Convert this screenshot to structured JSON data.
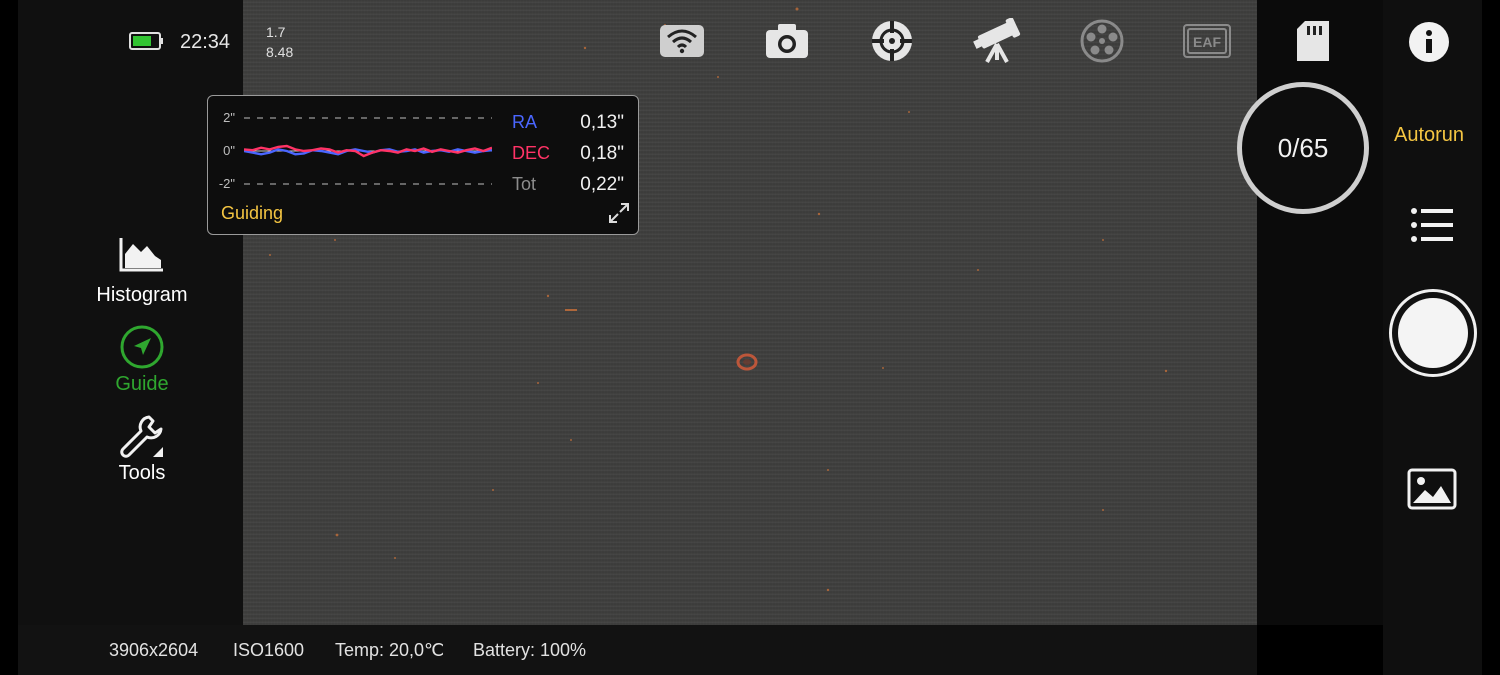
{
  "status": {
    "time": "22:34",
    "battery_level": 0.75,
    "metric_top": "1.7",
    "metric_bottom": "8.48"
  },
  "top_icons": [
    "wifi-icon",
    "camera-icon",
    "mount-crosshair-icon",
    "telescope-icon",
    "filter-wheel-icon",
    "eaf-focuser-icon",
    "sd-card-icon"
  ],
  "eaf_label": "EAF",
  "sidebar": {
    "items": [
      {
        "label": "Histogram",
        "icon": "histogram-icon",
        "color": "#ffffff"
      },
      {
        "label": "Guide",
        "icon": "guide-compass-icon",
        "color": "#2fa72f"
      },
      {
        "label": "Tools",
        "icon": "wrench-icon",
        "color": "#ffffff"
      }
    ]
  },
  "guiding": {
    "title": "Guiding",
    "axis_top": "2\"",
    "axis_mid": "0\"",
    "axis_bottom": "-2\"",
    "ra_label": "RA",
    "ra_value": "0,13\"",
    "dec_label": "DEC",
    "dec_value": "0,18\"",
    "tot_label": "Tot",
    "tot_value": "0,22\"",
    "colors": {
      "ra": "#4a66ff",
      "dec": "#ff3366",
      "title": "#f4c542"
    },
    "ra_series": [
      0.0,
      -0.1,
      -0.2,
      -0.1,
      0.1,
      0.0,
      -0.2,
      -0.15,
      0.05,
      0.0,
      -0.1,
      -0.2,
      0.0,
      0.1,
      0.0,
      -0.1,
      0.05,
      0.1,
      -0.05,
      0.0,
      0.1,
      -0.1,
      0.0,
      0.05,
      -0.05,
      0.1,
      0.0,
      -0.1,
      0.0,
      0.05
    ],
    "dec_series": [
      0.1,
      0.05,
      0.2,
      0.1,
      0.25,
      0.3,
      0.1,
      0.0,
      0.05,
      0.15,
      0.1,
      -0.1,
      0.05,
      0.0,
      -0.3,
      -0.1,
      0.05,
      0.0,
      -0.1,
      0.1,
      0.0,
      0.15,
      -0.05,
      0.1,
      0.0,
      -0.1,
      0.05,
      0.15,
      0.0,
      0.2
    ]
  },
  "capture": {
    "counter": "0/65",
    "autorun_label": "Autorun",
    "autorun_color": "#f4c542"
  },
  "bottom": {
    "resolution": "3906x2604",
    "iso": "ISO1600",
    "temp": "Temp: 20,0℃",
    "battery": "Battery: 100%"
  }
}
